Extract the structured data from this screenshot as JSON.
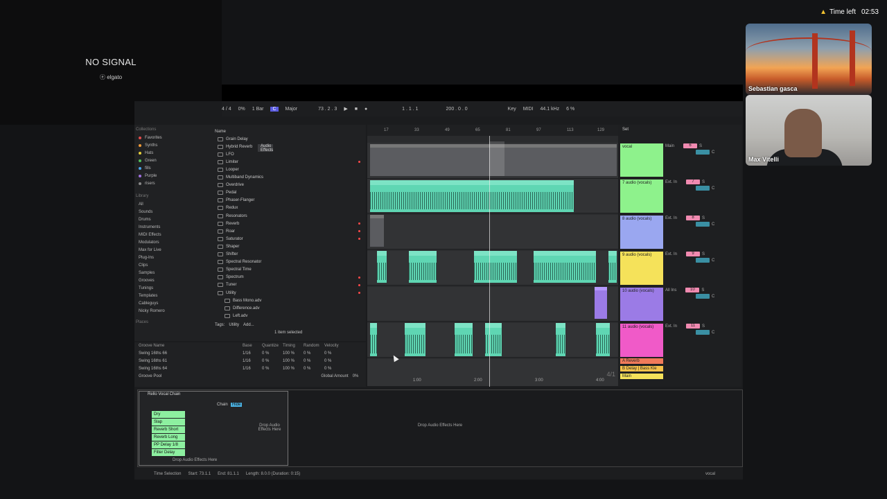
{
  "stream": {
    "no_signal": "NO SIGNAL",
    "brand": "elgato",
    "time_left_label": "Time left",
    "time_left_value": "02:53"
  },
  "participants": [
    {
      "name": "Sebastian gasca"
    },
    {
      "name": "Max Vitelli"
    }
  ],
  "transport": {
    "time_sig": "4 / 4",
    "percent": "0%",
    "quant": "1 Bar",
    "key": "C",
    "scale": "Major",
    "position": "73 . 2 . 3",
    "loop_start": "1 . 1 . 1",
    "loop_len": "200 . 0 . 0",
    "key_label": "Key",
    "midi_label": "MIDI",
    "sample_rate": "44.1 kHz",
    "cpu": "6 %"
  },
  "browser": {
    "collections_header": "Collections",
    "collections": [
      {
        "label": "Favorites",
        "color": "#e24b4b"
      },
      {
        "label": "Synths",
        "color": "#f09a37"
      },
      {
        "label": "Hats",
        "color": "#e6cf3a"
      },
      {
        "label": "Green",
        "color": "#52c25b"
      },
      {
        "label": "fills",
        "color": "#4aa3e8"
      },
      {
        "label": "Purple",
        "color": "#a070e0"
      },
      {
        "label": "risers",
        "color": "#888888"
      }
    ],
    "library_header": "Library",
    "library": [
      "All",
      "Sounds",
      "Drums",
      "Instruments",
      "Audio Effects",
      "MIDI Effects",
      "Modulators",
      "Max for Live",
      "Plug-Ins",
      "Clips",
      "Samples",
      "Grooves",
      "Tunings",
      "Templates",
      "Cableguys",
      "Nicky Romero"
    ],
    "places_header": "Places",
    "name_header": "Name",
    "items": [
      "Grain Delay",
      "Hybrid Reverb",
      "LFO",
      "Limiter",
      "Looper",
      "Multiband Dynamics",
      "Overdrive",
      "Pedal",
      "Phaser-Flanger",
      "Redux",
      "Resonators",
      "Reverb",
      "Roar",
      "Saturator",
      "Shaper",
      "Shifter",
      "Spectral Resonator",
      "Spectral Time",
      "Spectrum",
      "Tuner",
      "Utility",
      "Bass Mono.adv",
      "Difference.adv",
      "Left.adv"
    ],
    "tags_label": "Tags:",
    "tags_value": "Utility",
    "tags_add": "Add...",
    "selected_status": "1 item selected"
  },
  "groove": {
    "headers": [
      "Groove Name",
      "Base",
      "Quantize",
      "Timing",
      "Random",
      "Velocity"
    ],
    "rows": [
      [
        "Swing 16ths 66",
        "1/16",
        "0 %",
        "100 %",
        "0 %",
        "0 %"
      ],
      [
        "Swing 16ths 61",
        "1/16",
        "0 %",
        "100 %",
        "0 %",
        "0 %"
      ],
      [
        "Swing 16ths 64",
        "1/16",
        "0 %",
        "100 %",
        "0 %",
        "0 %"
      ]
    ],
    "pool_label": "Groove Pool",
    "global_amount_label": "Global Amount",
    "global_amount_value": "0%"
  },
  "arrangement": {
    "ruler": [
      "17",
      "33",
      "49",
      "65",
      "81",
      "97",
      "113",
      "129"
    ],
    "time_marks": [
      "1:00",
      "2:00",
      "3:00",
      "4:00"
    ],
    "zoom": "4/1",
    "clip_label": "audio (vocals)-123"
  },
  "tracks": [
    {
      "name": "vocal",
      "color": "#8ef28c",
      "route": "Main",
      "num": "6"
    },
    {
      "name": "7 audio (vocals)",
      "color": "#8ef28c",
      "route": "Ext. In",
      "num": "7"
    },
    {
      "name": "8 audio (vocals)",
      "color": "#9aa7f0",
      "route": "Ext. In",
      "num": "8"
    },
    {
      "name": "9 audio (vocals)",
      "color": "#f5e25a",
      "route": "Ext. In",
      "num": "9"
    },
    {
      "name": "10 audio (vocals)",
      "color": "#9b7be6",
      "route": "All Ins",
      "num": "10"
    },
    {
      "name": "11 audio (vocals)",
      "color": "#f05ac8",
      "route": "Ext. In",
      "num": "11"
    }
  ],
  "returns": [
    {
      "name": "A Reverb",
      "color": "#f07a5a"
    },
    {
      "name": "B Delay | Bass Kle",
      "color": "#f5c24a"
    },
    {
      "name": "Main",
      "color": "#f5e25a"
    }
  ],
  "set_label": "Set",
  "rack": {
    "title": "Rello Vocal Chain",
    "chain_label": "Chain",
    "hide_label": "Hide",
    "chains": [
      "Dry",
      "Slap",
      "Reverb Short",
      "Reverb Long",
      "PP Delay 1/8",
      "Filter Delay"
    ],
    "drop_hint": "Drop Audio Effects Here",
    "drop_hint_center": "Drop Audio Effects Here"
  },
  "status": {
    "selection": "Time Selection",
    "start": "Start: 73.1.1",
    "end": "End: 81.1.1",
    "length": "Length: 8.0.0  (Duration: 0:15)",
    "track": "vocal"
  }
}
